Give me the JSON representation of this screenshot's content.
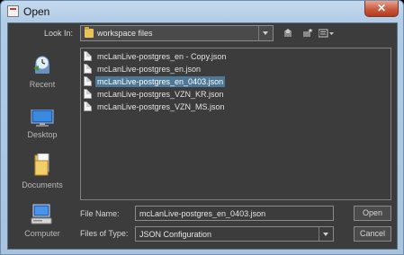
{
  "window": {
    "title": "Open",
    "close_glyph": "✕"
  },
  "lookin": {
    "label": "Look In:",
    "value": "workspace files"
  },
  "sidebar": {
    "items": [
      {
        "label": "Recent",
        "icon": "recent-icon"
      },
      {
        "label": "Desktop",
        "icon": "desktop-icon"
      },
      {
        "label": "Documents",
        "icon": "documents-icon"
      },
      {
        "label": "Computer",
        "icon": "computer-icon"
      }
    ]
  },
  "files": [
    {
      "name": "mcLanLive-postgres_en - Copy.json",
      "selected": false
    },
    {
      "name": "mcLanLive-postgres_en.json",
      "selected": false
    },
    {
      "name": "mcLanLive-postgres_en_0403.json",
      "selected": true
    },
    {
      "name": "mcLanLive-postgres_VZN_KR.json",
      "selected": false
    },
    {
      "name": "mcLanLive-postgres_VZN_MS.json",
      "selected": false
    }
  ],
  "filename": {
    "label": "File Name:",
    "value": "mcLanLive-postgres_en_0403.json"
  },
  "filetype": {
    "label": "Files of Type:",
    "value": "JSON Configuration"
  },
  "buttons": {
    "open": "Open",
    "cancel": "Cancel"
  },
  "colors": {
    "selection": "#4d7896",
    "panel": "#3c3c3c",
    "titlebar": "#b3cce6"
  }
}
